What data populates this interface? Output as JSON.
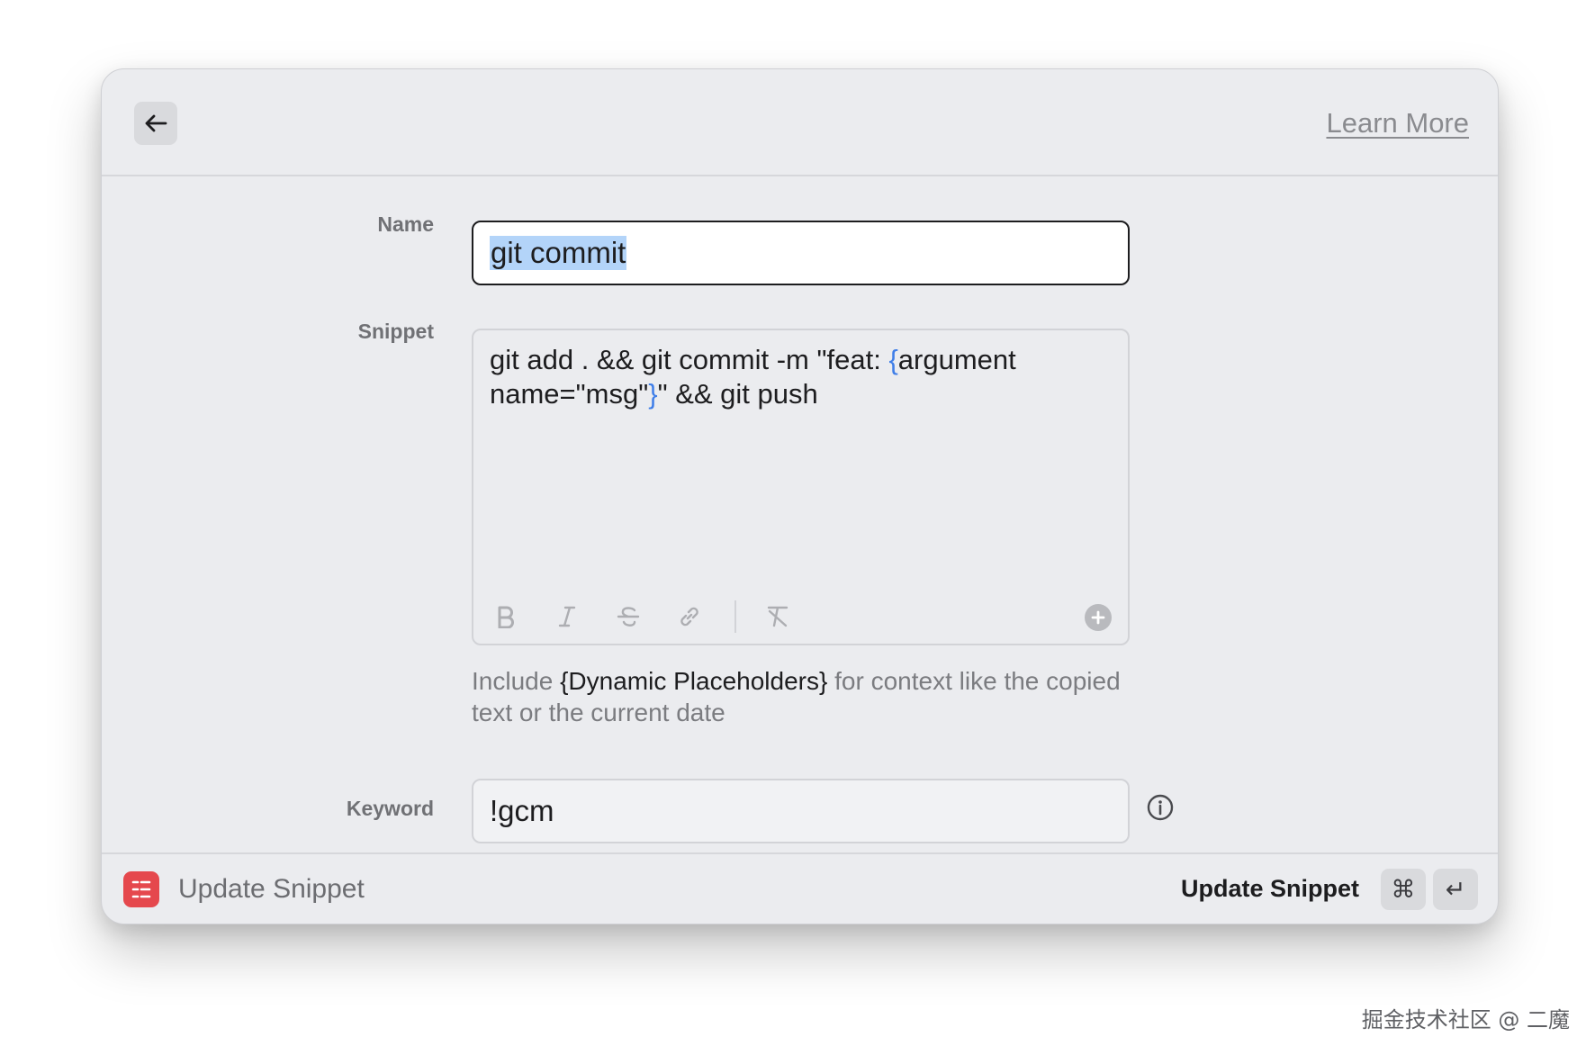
{
  "header": {
    "back_icon": "arrow-left-icon",
    "learn_more_label": "Learn More"
  },
  "form": {
    "name": {
      "label": "Name",
      "value": "git commit"
    },
    "snippet": {
      "label": "Snippet",
      "text_part1": "git add . && git commit -m \"feat: ",
      "brace_open": "{",
      "text_part2": "argument name=\"msg\"",
      "brace_close": "}",
      "text_part3": "\" && git push",
      "toolbar": [
        "bold-icon",
        "italic-icon",
        "strikethrough-icon",
        "link-icon",
        "clear-format-icon",
        "add-placeholder-icon"
      ]
    },
    "hint": {
      "prefix": "Include ",
      "highlight": "{Dynamic Placeholders}",
      "suffix": " for context like the copied text or the current date"
    },
    "keyword": {
      "label": "Keyword",
      "value": "!gcm",
      "info_icon": "info-icon"
    }
  },
  "footer": {
    "app_icon": "snippets-app-icon",
    "title": "Update Snippet",
    "action_label": "Update Snippet",
    "shortcut_keys": [
      "⌘",
      "↵"
    ]
  },
  "watermark": "掘金技术社区 @ 二魔",
  "colors": {
    "window_bg": "#ebecef",
    "placeholder_brace": "#3f7ee8",
    "selection": "#b3d4f9",
    "app_icon": "#e5484d"
  }
}
